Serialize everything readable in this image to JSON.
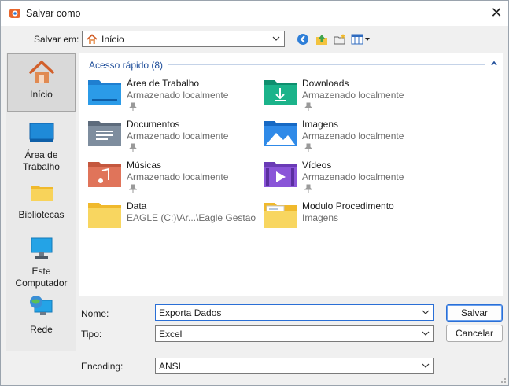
{
  "window": {
    "title": "Salvar como",
    "close_glyph": "✕"
  },
  "location": {
    "label": "Salvar em:",
    "value": "Início"
  },
  "toolbar": {
    "icons": [
      "back-icon",
      "up-folder-icon",
      "new-folder-icon",
      "view-menu-icon"
    ]
  },
  "places": [
    {
      "label": "Início",
      "icon": "home-icon"
    },
    {
      "label": "Área de Trabalho",
      "icon": "desktop-icon"
    },
    {
      "label": "Bibliotecas",
      "icon": "libraries-icon"
    },
    {
      "label": "Este Computador",
      "icon": "computer-icon"
    },
    {
      "label": "Rede",
      "icon": "network-icon"
    }
  ],
  "group": {
    "title": "Acesso rápido (8)"
  },
  "items": [
    {
      "name": "Área de Trabalho",
      "sub": "Armazenado localmente",
      "pinned": true,
      "icon": "desktop-folder-icon"
    },
    {
      "name": "Downloads",
      "sub": "Armazenado localmente",
      "pinned": true,
      "icon": "downloads-folder-icon"
    },
    {
      "name": "Documentos",
      "sub": "Armazenado localmente",
      "pinned": true,
      "icon": "documents-folder-icon"
    },
    {
      "name": "Imagens",
      "sub": "Armazenado localmente",
      "pinned": true,
      "icon": "pictures-folder-icon"
    },
    {
      "name": "Músicas",
      "sub": "Armazenado localmente",
      "pinned": true,
      "icon": "music-folder-icon"
    },
    {
      "name": "Vídeos",
      "sub": "Armazenado localmente",
      "pinned": true,
      "icon": "videos-folder-icon"
    },
    {
      "name": "Data",
      "sub": "EAGLE (C:)\\Ar...\\Eagle Gestao",
      "pinned": false,
      "icon": "folder-icon"
    },
    {
      "name": "Modulo Procedimento",
      "sub": "Imagens",
      "pinned": false,
      "icon": "folder-icon"
    }
  ],
  "form": {
    "name_label": "Nome:",
    "name_value": "Exporta Dados",
    "type_label": "Tipo:",
    "type_value": "Excel",
    "encoding_label": "Encoding:",
    "encoding_value": "ANSI"
  },
  "buttons": {
    "save": "Salvar",
    "cancel": "Cancelar"
  },
  "colors": {
    "accent": "#2a6fd6",
    "group_title": "#1f4e9a",
    "folder_yellow": "#f5c542"
  }
}
